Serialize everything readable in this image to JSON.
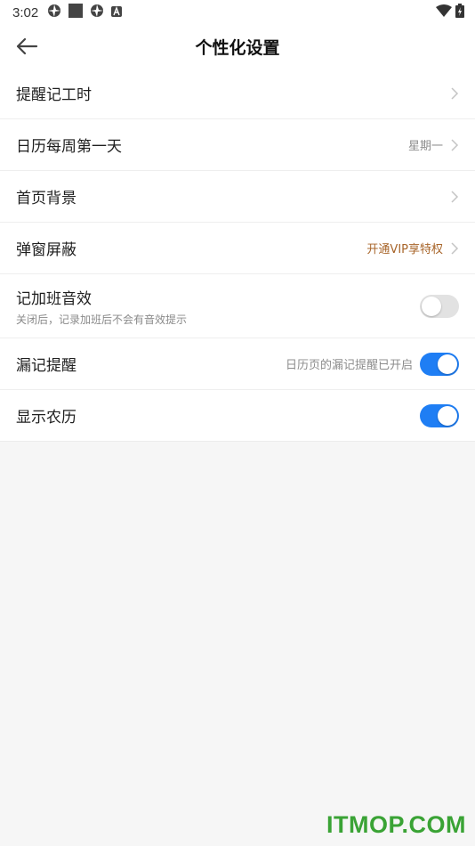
{
  "status_bar": {
    "time": "3:02"
  },
  "header": {
    "title": "个性化设置"
  },
  "settings": {
    "reminder": {
      "label": "提醒记工时"
    },
    "week_start": {
      "label": "日历每周第一天",
      "value": "星期一"
    },
    "home_background": {
      "label": "首页背景"
    },
    "popup_block": {
      "label": "弹窗屏蔽",
      "value": "开通VIP享特权"
    },
    "overtime_sound": {
      "label": "记加班音效",
      "sub": "关闭后，记录加班后不会有音效提示",
      "enabled": false
    },
    "missed_reminder": {
      "label": "漏记提醒",
      "value": "日历页的漏记提醒已开启",
      "enabled": true
    },
    "lunar": {
      "label": "显示农历",
      "enabled": true
    }
  },
  "colors": {
    "accent": "#1f7ef4",
    "vip": "#a8652a",
    "watermark": "#3aa335"
  },
  "watermark": "ITMOP.COM"
}
